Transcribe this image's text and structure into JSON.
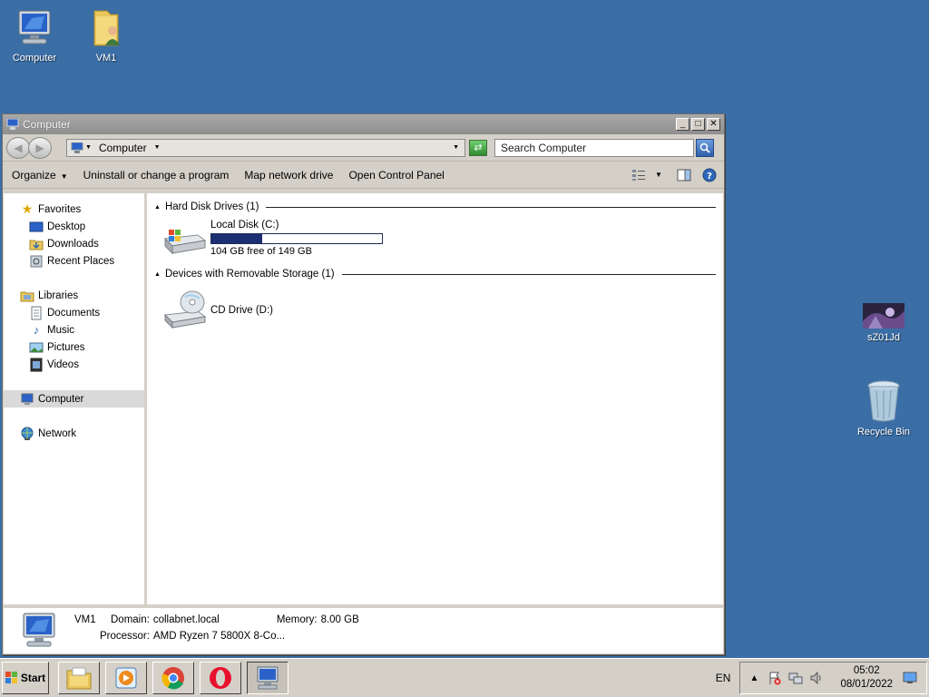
{
  "desktop": {
    "icons": [
      {
        "label": "Computer"
      },
      {
        "label": "VM1"
      },
      {
        "label": "sZ01Jd"
      },
      {
        "label": "Recycle Bin"
      }
    ]
  },
  "window": {
    "title": "Computer",
    "address": {
      "crumb": "Computer"
    },
    "search_placeholder": "Search Computer",
    "commands": {
      "organize": "Organize",
      "uninstall": "Uninstall or change a program",
      "map_drive": "Map network drive",
      "control_panel": "Open Control Panel"
    },
    "nav": {
      "favorites": "Favorites",
      "desktop": "Desktop",
      "downloads": "Downloads",
      "recent": "Recent Places",
      "libraries": "Libraries",
      "documents": "Documents",
      "music": "Music",
      "pictures": "Pictures",
      "videos": "Videos",
      "computer": "Computer",
      "network": "Network"
    },
    "groups": {
      "hdd": {
        "title": "Hard Disk Drives (1)"
      },
      "removable": {
        "title": "Devices with Removable Storage (1)"
      }
    },
    "drives": {
      "c": {
        "name": "Local Disk (C:)",
        "free_text": "104 GB free of 149 GB",
        "used_fraction": 0.3
      },
      "d": {
        "name": "CD Drive (D:)"
      }
    },
    "details": {
      "name": "VM1",
      "domain_label": "Domain:",
      "domain": "collabnet.local",
      "memory_label": "Memory:",
      "memory": "8.00 GB",
      "processor_label": "Processor:",
      "processor": "AMD Ryzen 7 5800X 8-Co..."
    }
  },
  "taskbar": {
    "start": "Start",
    "language": "EN",
    "time": "05:02",
    "date": "08/01/2022"
  }
}
